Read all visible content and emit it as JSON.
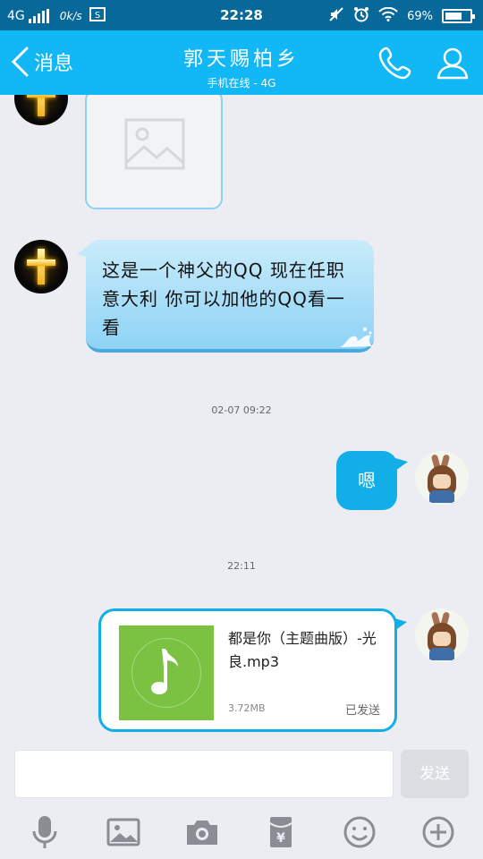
{
  "status_bar": {
    "network": "4G",
    "speed": "0k/s",
    "time": "22:28",
    "battery": "69%",
    "battery_level": 0.69
  },
  "header": {
    "back_label": "消息",
    "title": "郭天赐柏乡",
    "subtitle": "手机在线 - 4G"
  },
  "messages": [
    {
      "from": "contact",
      "type": "image"
    },
    {
      "from": "contact",
      "type": "text",
      "text": "这是一个神父的QQ  现在任职意大利 你可以加他的QQ看一看"
    },
    {
      "type": "timestamp",
      "text": "02-07 09:22"
    },
    {
      "from": "me",
      "type": "text",
      "text": "嗯"
    },
    {
      "type": "timestamp",
      "text": "22:11"
    },
    {
      "from": "me",
      "type": "file",
      "file_name": "都是你（主题曲版）-光良.mp3",
      "file_size": "3.72MB",
      "status": "已发送"
    }
  ],
  "input": {
    "placeholder": "",
    "send_label": "发送"
  },
  "toolbar": [
    "microphone-icon",
    "image-icon",
    "camera-icon",
    "red-packet-icon",
    "emoji-icon",
    "plus-icon"
  ],
  "colors": {
    "status_bar": "#07689a",
    "title_bar": "#12b7f5",
    "sent_bubble": "#12aee8",
    "background": "#ebedf2",
    "music_thumb": "#7cc242"
  }
}
